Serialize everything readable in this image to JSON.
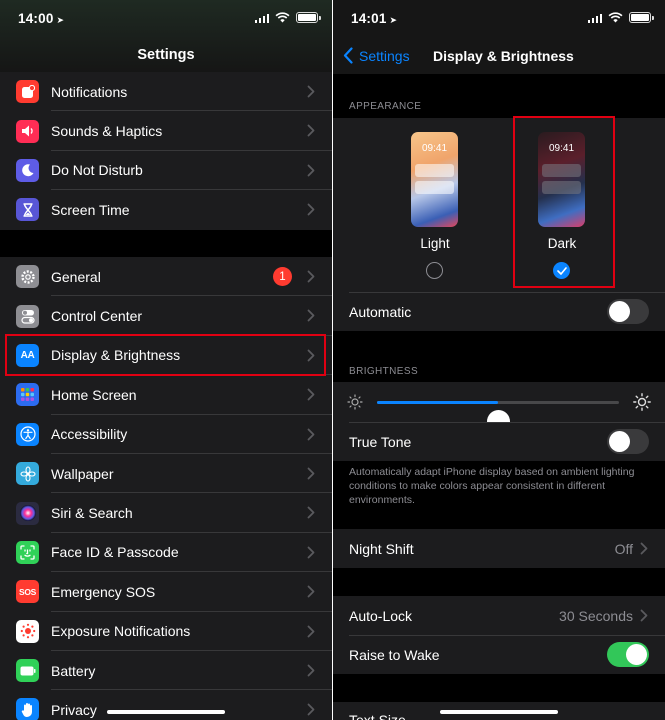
{
  "left": {
    "status": {
      "time": "14:00"
    },
    "title": "Settings",
    "group1": [
      {
        "label": "Notifications",
        "icon": "notifications-icon",
        "color": "#ff3b30"
      },
      {
        "label": "Sounds & Haptics",
        "icon": "speaker-icon",
        "color": "#ff2d55"
      },
      {
        "label": "Do Not Disturb",
        "icon": "moon-icon",
        "color": "#5e5ce6"
      },
      {
        "label": "Screen Time",
        "icon": "hourglass-icon",
        "color": "#5856d6"
      }
    ],
    "group2": [
      {
        "label": "General",
        "icon": "gear-icon",
        "color": "#8e8e93",
        "badge": "1"
      },
      {
        "label": "Control Center",
        "icon": "toggles-icon",
        "color": "#8e8e93"
      },
      {
        "label": "Display & Brightness",
        "icon": "text-size-icon",
        "color": "#0a84ff",
        "glyph": "AA"
      },
      {
        "label": "Home Screen",
        "icon": "app-grid-icon",
        "color": "#2c6cf0"
      },
      {
        "label": "Accessibility",
        "icon": "accessibility-icon",
        "color": "#0a84ff"
      },
      {
        "label": "Wallpaper",
        "icon": "flower-icon",
        "color": "#34aadc"
      },
      {
        "label": "Siri & Search",
        "icon": "siri-icon",
        "color": "#2b2b40"
      },
      {
        "label": "Face ID & Passcode",
        "icon": "face-id-icon",
        "color": "#30d158"
      },
      {
        "label": "Emergency SOS",
        "icon": "sos-icon",
        "color": "#ff3b30",
        "glyph": "SOS"
      },
      {
        "label": "Exposure Notifications",
        "icon": "exposure-icon",
        "color": "#ffffff"
      },
      {
        "label": "Battery",
        "icon": "battery-icon",
        "color": "#30d158"
      },
      {
        "label": "Privacy",
        "icon": "hand-icon",
        "color": "#0a84ff"
      }
    ]
  },
  "right": {
    "status": {
      "time": "14:01"
    },
    "back_label": "Settings",
    "title": "Display & Brightness",
    "appearance_header": "APPEARANCE",
    "light": {
      "label": "Light",
      "time": "09:41",
      "selected": false
    },
    "dark": {
      "label": "Dark",
      "time": "09:41",
      "selected": true
    },
    "automatic": {
      "label": "Automatic",
      "on": false
    },
    "brightness_header": "BRIGHTNESS",
    "brightness_level": 0.5,
    "true_tone": {
      "label": "True Tone",
      "on": false
    },
    "true_tone_note": "Automatically adapt iPhone display based on ambient lighting conditions to make colors appear consistent in different environments.",
    "night_shift": {
      "label": "Night Shift",
      "value": "Off"
    },
    "auto_lock": {
      "label": "Auto-Lock",
      "value": "30 Seconds"
    },
    "raise_to_wake": {
      "label": "Raise to Wake",
      "on": true
    },
    "text_size": {
      "label": "Text Size"
    }
  },
  "colors": {
    "accent": "#0a84ff",
    "highlight": "#e00012",
    "toggle_on": "#32c759"
  }
}
